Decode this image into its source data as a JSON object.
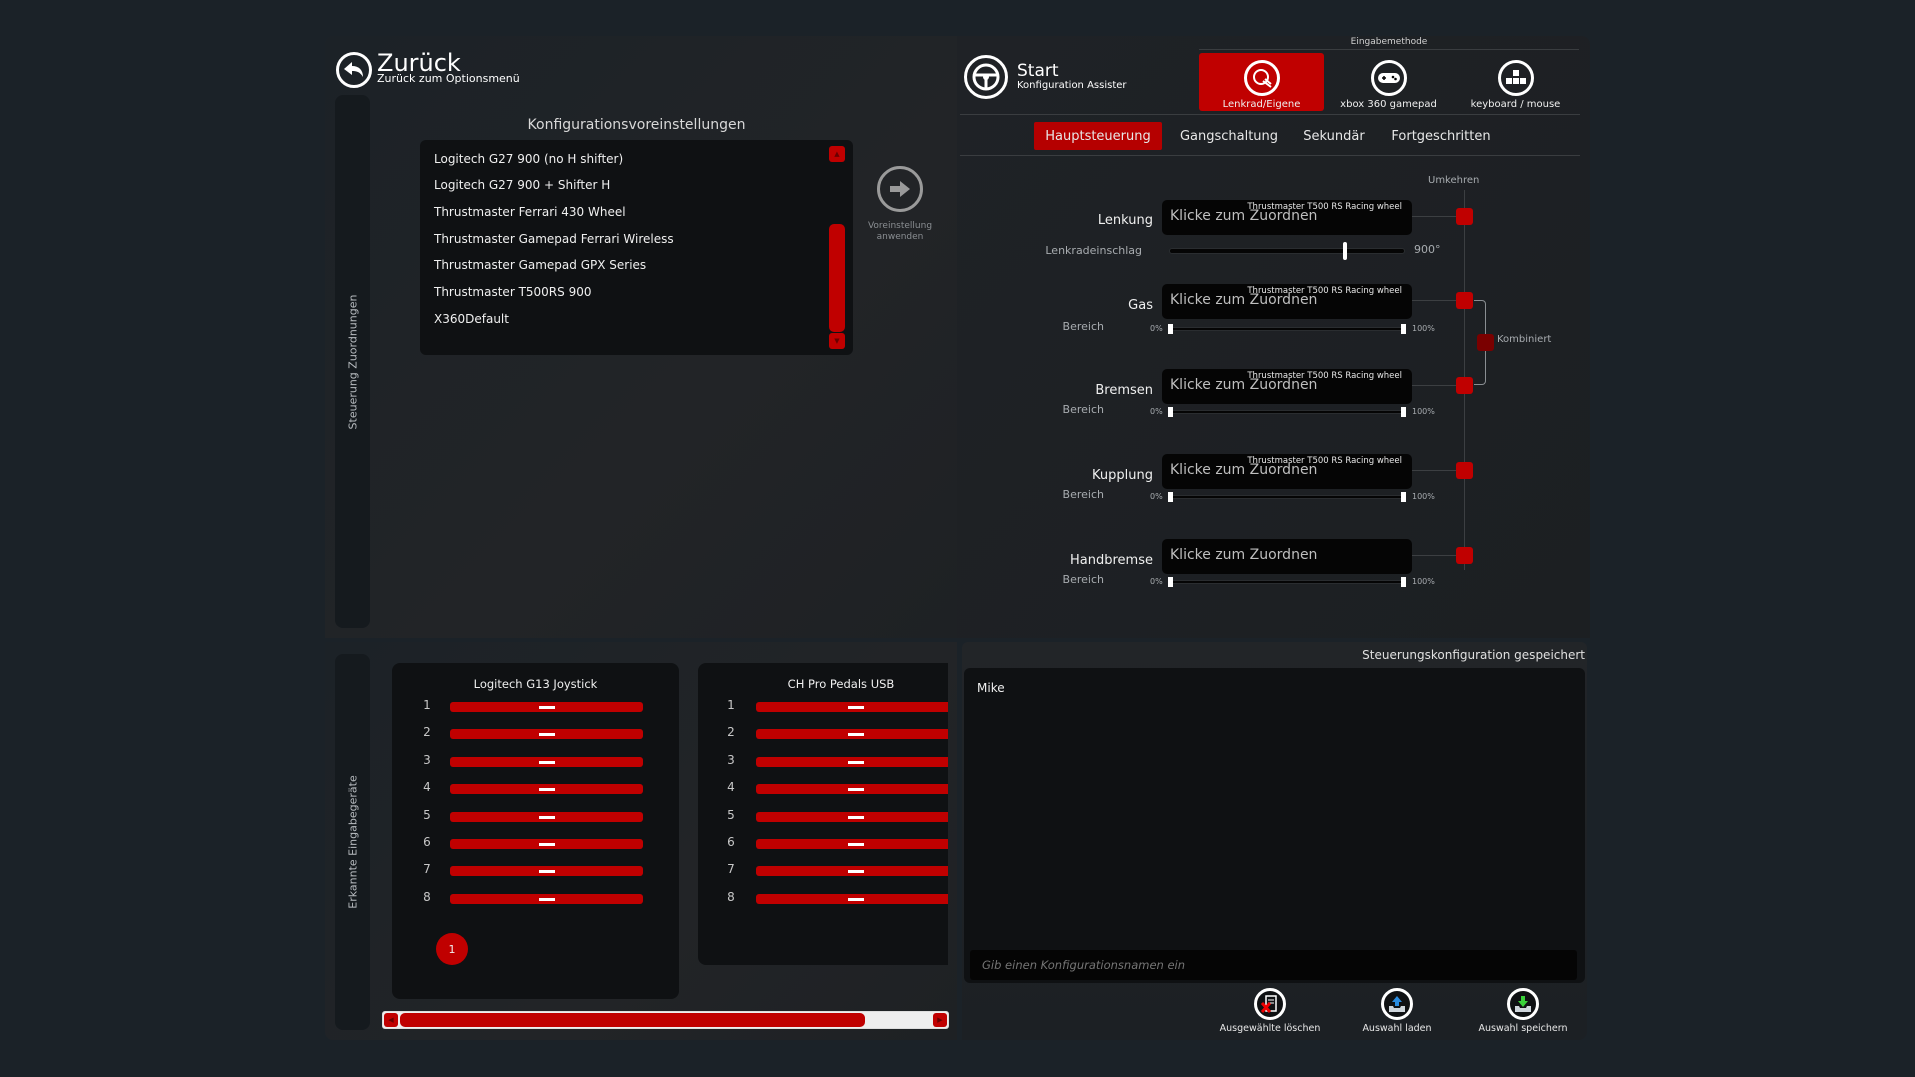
{
  "header_left": {
    "back_title": "Zurück",
    "back_subtitle": "Zurück zum Optionsmenü",
    "side_rail_label": "Steuerung Zuordnungen"
  },
  "presets": {
    "title": "Konfigurationsvoreinstellungen",
    "items": [
      "Logitech G27 900 (no H shifter)",
      "Logitech G27 900 + Shifter H",
      "Thrustmaster Ferrari 430 Wheel",
      "Thrustmaster Gamepad Ferrari Wireless",
      "Thrustmaster Gamepad GPX Series",
      "Thrustmaster T500RS 900",
      "X360Default"
    ],
    "apply_label_line1": "Voreinstellung",
    "apply_label_line2": "anwenden"
  },
  "header_right": {
    "start_title": "Start",
    "start_subtitle": "Konfiguration Assister",
    "input_method_label": "Eingabemethode",
    "input_methods": [
      {
        "label": "Lenkrad/Eigene",
        "icon": "steering-wheel-icon",
        "active": true
      },
      {
        "label": "xbox 360 gamepad",
        "icon": "gamepad-icon",
        "active": false
      },
      {
        "label": "keyboard / mouse",
        "icon": "keyboard-icon",
        "active": false
      }
    ]
  },
  "tabs": [
    {
      "label": "Hauptsteuerung",
      "active": true
    },
    {
      "label": "Gangschaltung",
      "active": false
    },
    {
      "label": "Sekundär",
      "active": false
    },
    {
      "label": "Fortgeschritten",
      "active": false
    }
  ],
  "mappings": {
    "invert_header": "Umkehren",
    "combined_label": "Kombiniert",
    "click_to_assign": "Klicke zum Zuordnen",
    "range_label": "Bereich",
    "range_min_label": "0%",
    "range_max_label": "100%",
    "rows": [
      {
        "label": "Lenkung",
        "device": "Thrustmaster T500 RS Racing wheel",
        "value": "Klicke zum Zuordnen"
      },
      {
        "label": "Gas",
        "device": "Thrustmaster T500 RS Racing wheel",
        "value": "Klicke zum Zuordnen"
      },
      {
        "label": "Bremsen",
        "device": "Thrustmaster T500 RS Racing wheel",
        "value": "Klicke zum Zuordnen"
      },
      {
        "label": "Kupplung",
        "device": "Thrustmaster T500 RS Racing wheel",
        "value": "Klicke zum Zuordnen"
      },
      {
        "label": "Handbremse",
        "device": "",
        "value": "Klicke zum Zuordnen"
      }
    ],
    "steering_lock": {
      "label": "Lenkradeinschlag",
      "value": "900°",
      "fraction": 0.75
    },
    "ranges": {
      "min": 0,
      "max": 100
    }
  },
  "devices": {
    "side_rail_label": "Erkannte Eingabegeräte",
    "cards": [
      {
        "name": "Logitech G13 Joystick",
        "axes": [
          "1",
          "2",
          "3",
          "4",
          "5",
          "6",
          "7",
          "8"
        ],
        "buttons_pressed": [
          "1"
        ]
      },
      {
        "name": "CH Pro Pedals USB",
        "axes": [
          "1",
          "2",
          "3",
          "4",
          "5",
          "6",
          "7",
          "8"
        ],
        "buttons_pressed": []
      }
    ],
    "hscroll_fraction": 0.9
  },
  "saved_configs": {
    "status": "Steuerungskonfiguration gespeichert",
    "items": [
      "Mike"
    ],
    "name_placeholder": "Gib einen Konfigurationsnamen ein",
    "actions": [
      {
        "label": "Ausgewählte löschen",
        "icon": "delete-file-icon"
      },
      {
        "label": "Auswahl laden",
        "icon": "load-tray-icon"
      },
      {
        "label": "Auswahl speichern",
        "icon": "save-tray-icon"
      }
    ]
  },
  "colors": {
    "accent": "#c00000",
    "background": "#1b2228",
    "panel_dark": "#0f1113"
  }
}
